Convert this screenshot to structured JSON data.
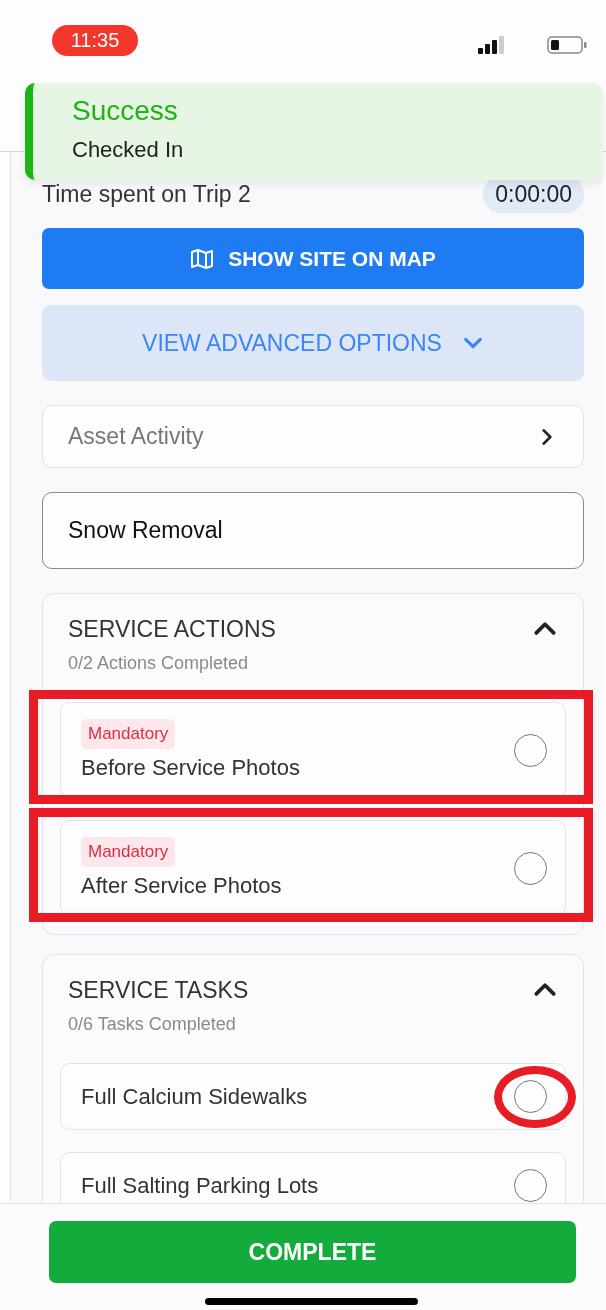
{
  "status_bar": {
    "time": "11:35"
  },
  "toast": {
    "title": "Success",
    "message": "Checked In"
  },
  "trip": {
    "label": "Time spent on Trip 2",
    "timer": "0:00:00"
  },
  "map_button": {
    "label": "SHOW SITE ON MAP"
  },
  "advanced_button": {
    "label": "VIEW ADVANCED OPTIONS",
    "expanded": false
  },
  "asset_activity": {
    "label": "Asset Activity"
  },
  "service_field": {
    "value": "Snow Removal"
  },
  "sections": [
    {
      "title": "SERVICE ACTIONS",
      "subtitle": "0/2 Actions Completed",
      "expanded": true,
      "items": [
        {
          "tag": "Mandatory",
          "label": "Before Service Photos",
          "checked": false,
          "highlighted": true,
          "circled": false
        },
        {
          "tag": "Mandatory",
          "label": "After Service Photos",
          "checked": false,
          "highlighted": true,
          "circled": false
        }
      ]
    },
    {
      "title": "SERVICE TASKS",
      "subtitle": "0/6 Tasks Completed",
      "expanded": true,
      "items": [
        {
          "label": "Full Calcium Sidewalks",
          "checked": false,
          "highlighted": false,
          "circled": true
        },
        {
          "label": "Full Salting Parking Lots",
          "checked": false,
          "highlighted": false,
          "circled": false
        }
      ]
    }
  ],
  "complete_button": {
    "label": "COMPLETE"
  }
}
